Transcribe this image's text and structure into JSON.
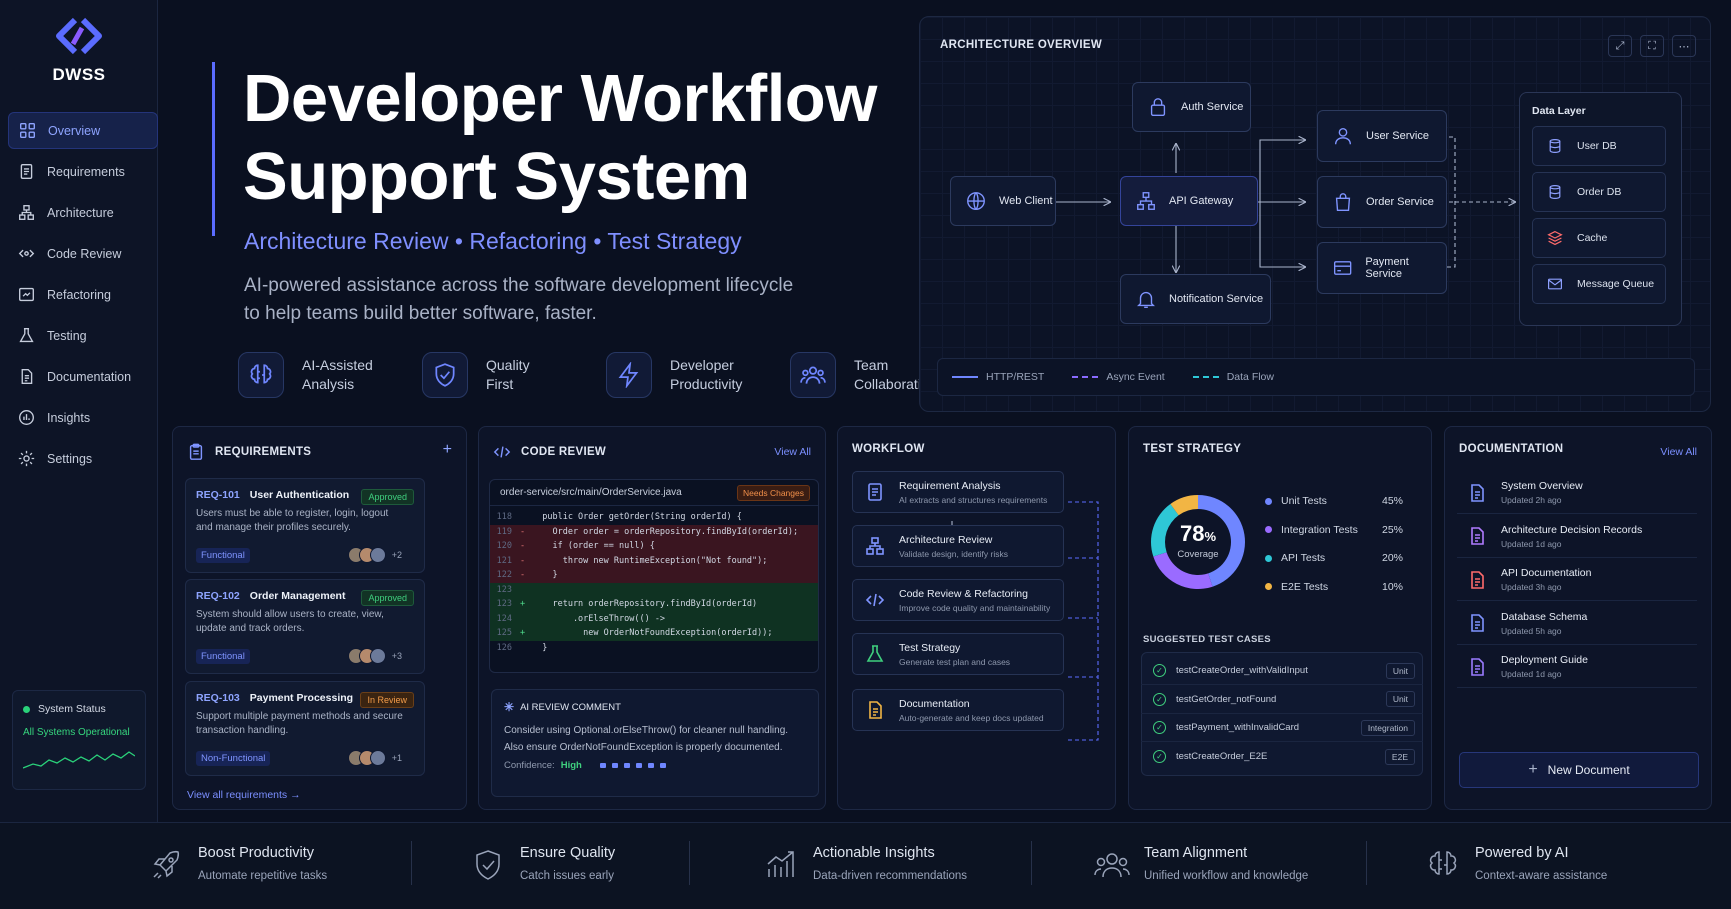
{
  "brand": {
    "name": "DWSS"
  },
  "sidebar": {
    "items": [
      {
        "label": "Overview",
        "icon": "grid-icon"
      },
      {
        "label": "Requirements",
        "icon": "document-icon"
      },
      {
        "label": "Architecture",
        "icon": "hierarchy-icon"
      },
      {
        "label": "Code Review",
        "icon": "code-review-icon"
      },
      {
        "label": "Refactoring",
        "icon": "refactor-icon"
      },
      {
        "label": "Testing",
        "icon": "flask-icon"
      },
      {
        "label": "Documentation",
        "icon": "doc-icon"
      },
      {
        "label": "Insights",
        "icon": "insights-icon"
      },
      {
        "label": "Settings",
        "icon": "gear-icon"
      }
    ],
    "status": {
      "title": "System Status",
      "text": "All Systems Operational"
    }
  },
  "hero": {
    "title_line1": "Developer Workflow",
    "title_line2": "Support System",
    "subtitle": "Architecture Review • Refactoring • Test Strategy",
    "desc_line1": "AI-powered assistance across the software development lifecycle",
    "desc_line2": "to help teams build better software, faster.",
    "features": [
      {
        "line1": "AI-Assisted",
        "line2": "Analysis",
        "icon": "brain-icon"
      },
      {
        "line1": "Quality",
        "line2": "First",
        "icon": "shield-check-icon"
      },
      {
        "line1": "Developer",
        "line2": "Productivity",
        "icon": "bolt-icon"
      },
      {
        "line1": "Team",
        "line2": "Collaboration",
        "icon": "team-icon"
      }
    ]
  },
  "architecture": {
    "title": "ARCHITECTURE OVERVIEW",
    "nodes": {
      "web": "Web Client",
      "auth": "Auth Service",
      "gateway": "API Gateway",
      "notify": "Notification Service",
      "user": "User Service",
      "order": "Order Service",
      "payment": "Payment Service"
    },
    "data_layer": {
      "title": "Data Layer",
      "items": [
        "User DB",
        "Order DB",
        "Cache",
        "Message Queue"
      ]
    },
    "legend": [
      "HTTP/REST",
      "Async Event",
      "Data Flow"
    ]
  },
  "requirements": {
    "title": "REQUIREMENTS",
    "add": "+",
    "items": [
      {
        "id": "REQ-101",
        "name": "User Authentication",
        "status": "Approved",
        "desc": "Users must be able to register, login, logout and manage their profiles securely.",
        "tag": "Functional",
        "extra": "+2"
      },
      {
        "id": "REQ-102",
        "name": "Order Management",
        "status": "Approved",
        "desc": "System should allow users to create, view, update and track orders.",
        "tag": "Functional",
        "extra": "+3"
      },
      {
        "id": "REQ-103",
        "name": "Payment Processing",
        "status": "In Review",
        "desc": "Support multiple payment methods and secure transaction handling.",
        "tag": "Non-Functional",
        "extra": "+1"
      }
    ],
    "view_all": "View all requirements →"
  },
  "code_review": {
    "title": "CODE REVIEW",
    "view_all": "View All",
    "file": "order-service/src/main/OrderService.java",
    "file_status": "Needs Changes",
    "lines": [
      {
        "n": "118",
        "s": "",
        "t": "  public Order getOrder(String orderId) {",
        "k": "ctx"
      },
      {
        "n": "119",
        "s": "-",
        "t": "    Order order = orderRepository.findById(orderId);",
        "k": "del"
      },
      {
        "n": "120",
        "s": "-",
        "t": "    if (order == null) {",
        "k": "del"
      },
      {
        "n": "121",
        "s": "-",
        "t": "      throw new RuntimeException(\"Not found\");",
        "k": "del"
      },
      {
        "n": "122",
        "s": "-",
        "t": "    }",
        "k": "del"
      },
      {
        "n": "123",
        "s": "",
        "t": "",
        "k": "add"
      },
      {
        "n": "123",
        "s": "+",
        "t": "    return orderRepository.findById(orderId)",
        "k": "add"
      },
      {
        "n": "124",
        "s": "",
        "t": "        .orElseThrow(() ->",
        "k": "add"
      },
      {
        "n": "125",
        "s": "+",
        "t": "          new OrderNotFoundException(orderId));",
        "k": "add"
      },
      {
        "n": "126",
        "s": "",
        "t": "  }",
        "k": "ctx"
      }
    ],
    "ai": {
      "title": "AI REVIEW COMMENT",
      "line1": "Consider using Optional.orElseThrow() for cleaner null handling.",
      "line2": "Also ensure OrderNotFoundException is properly documented.",
      "confidence_label": "Confidence:",
      "confidence": "High"
    }
  },
  "workflow": {
    "title": "WORKFLOW",
    "steps": [
      {
        "title": "Requirement Analysis",
        "desc": "AI extracts and structures requirements",
        "icon": "document-icon",
        "color": "#7f94ff"
      },
      {
        "title": "Architecture Review",
        "desc": "Validate design, identify risks",
        "icon": "hierarchy-icon",
        "color": "#7f94ff"
      },
      {
        "title": "Code Review & Refactoring",
        "desc": "Improve code quality and maintainability",
        "icon": "code-icon",
        "color": "#7f94ff"
      },
      {
        "title": "Test Strategy",
        "desc": "Generate test plan and cases",
        "icon": "flask-icon",
        "color": "#3fcf7e"
      },
      {
        "title": "Documentation",
        "desc": "Auto-generate and keep docs updated",
        "icon": "doc-icon",
        "color": "#f2b544"
      }
    ]
  },
  "test_strategy": {
    "title": "TEST STRATEGY",
    "coverage": {
      "value": "78",
      "unit": "%",
      "label": "Coverage"
    },
    "chart_data": {
      "type": "pie",
      "categories": [
        "Unit Tests",
        "Integration Tests",
        "API Tests",
        "E2E Tests"
      ],
      "values": [
        45,
        25,
        20,
        10
      ],
      "labels": [
        "45%",
        "25%",
        "20%",
        "10%"
      ],
      "colors": [
        "#6f86ff",
        "#9a6bff",
        "#2ec7d6",
        "#f2b544"
      ]
    },
    "cases_title": "SUGGESTED TEST CASES",
    "cases": [
      {
        "name": "testCreateOrder_withValidInput",
        "type": "Unit"
      },
      {
        "name": "testGetOrder_notFound",
        "type": "Unit"
      },
      {
        "name": "testPayment_withInvalidCard",
        "type": "Integration"
      },
      {
        "name": "testCreateOrder_E2E",
        "type": "E2E"
      }
    ]
  },
  "documentation": {
    "title": "DOCUMENTATION",
    "view_all": "View All",
    "items": [
      {
        "title": "System Overview",
        "updated": "Updated 2h ago",
        "color": "#7f94ff"
      },
      {
        "title": "Architecture Decision Records",
        "updated": "Updated 1d ago",
        "color": "#b07bff"
      },
      {
        "title": "API Documentation",
        "updated": "Updated 3h ago",
        "color": "#ff6b6b"
      },
      {
        "title": "Database Schema",
        "updated": "Updated 5h ago",
        "color": "#7f94ff"
      },
      {
        "title": "Deployment Guide",
        "updated": "Updated 1d ago",
        "color": "#9a7bff"
      }
    ],
    "new_button": "New Document"
  },
  "footer": {
    "items": [
      {
        "title": "Boost Productivity",
        "desc": "Automate repetitive tasks",
        "icon": "rocket-icon"
      },
      {
        "title": "Ensure Quality",
        "desc": "Catch issues early",
        "icon": "shield-check-icon"
      },
      {
        "title": "Actionable Insights",
        "desc": "Data-driven recommendations",
        "icon": "chart-up-icon"
      },
      {
        "title": "Team Alignment",
        "desc": "Unified workflow and knowledge",
        "icon": "team-icon"
      },
      {
        "title": "Powered by AI",
        "desc": "Context-aware assistance",
        "icon": "brain-icon"
      }
    ]
  }
}
